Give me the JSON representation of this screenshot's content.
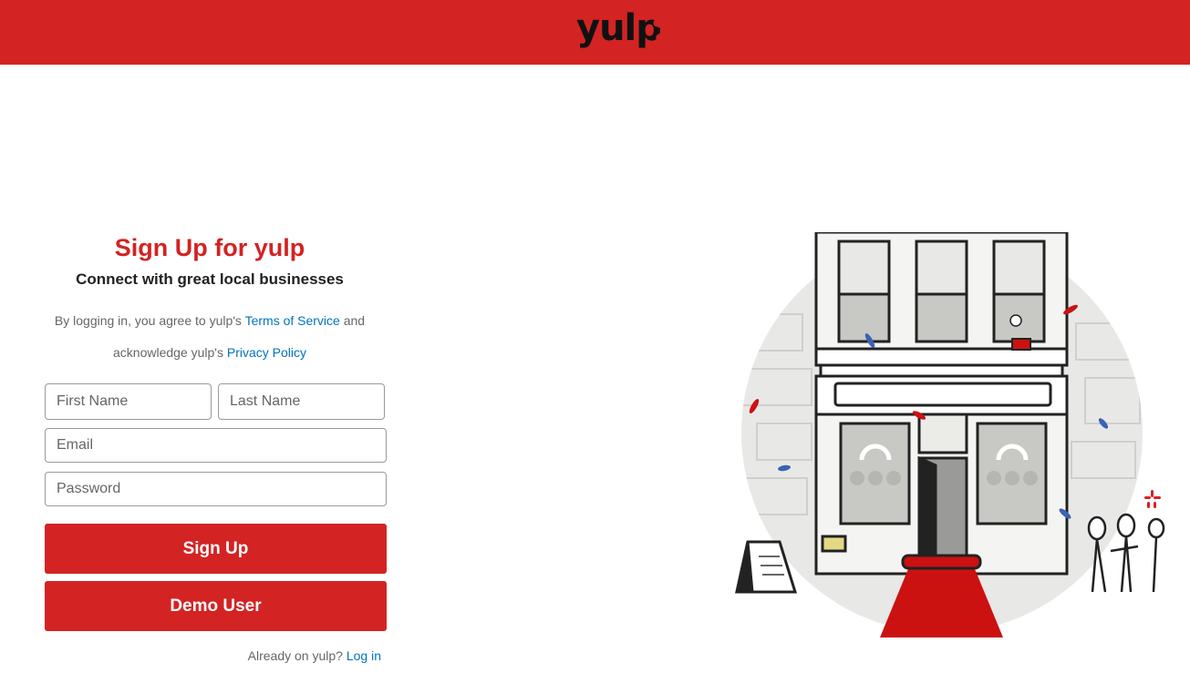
{
  "header": {
    "logo_text": "yulp",
    "background_color": "#d32323",
    "logo_icon": "yelp-burst-icon"
  },
  "signup": {
    "title": "Sign Up for yulp",
    "subtitle": "Connect with great local businesses",
    "legal_prefix": "By logging in, you agree to yulp's ",
    "terms_link": "Terms of Service",
    "legal_middle": " and",
    "legal_prefix2": "acknowledge yulp's ",
    "privacy_link": "Privacy Policy",
    "first_name_placeholder": "First Name",
    "last_name_placeholder": "Last Name",
    "email_placeholder": "Email",
    "password_placeholder": "Password",
    "signup_button": "Sign Up",
    "demo_button": "Demo User",
    "already_text": "Already on yulp? ",
    "login_link": "Log in"
  },
  "colors": {
    "brand_red": "#d32323",
    "link_blue": "#0073bb"
  },
  "illustration": {
    "icon": "storefront-illustration"
  }
}
